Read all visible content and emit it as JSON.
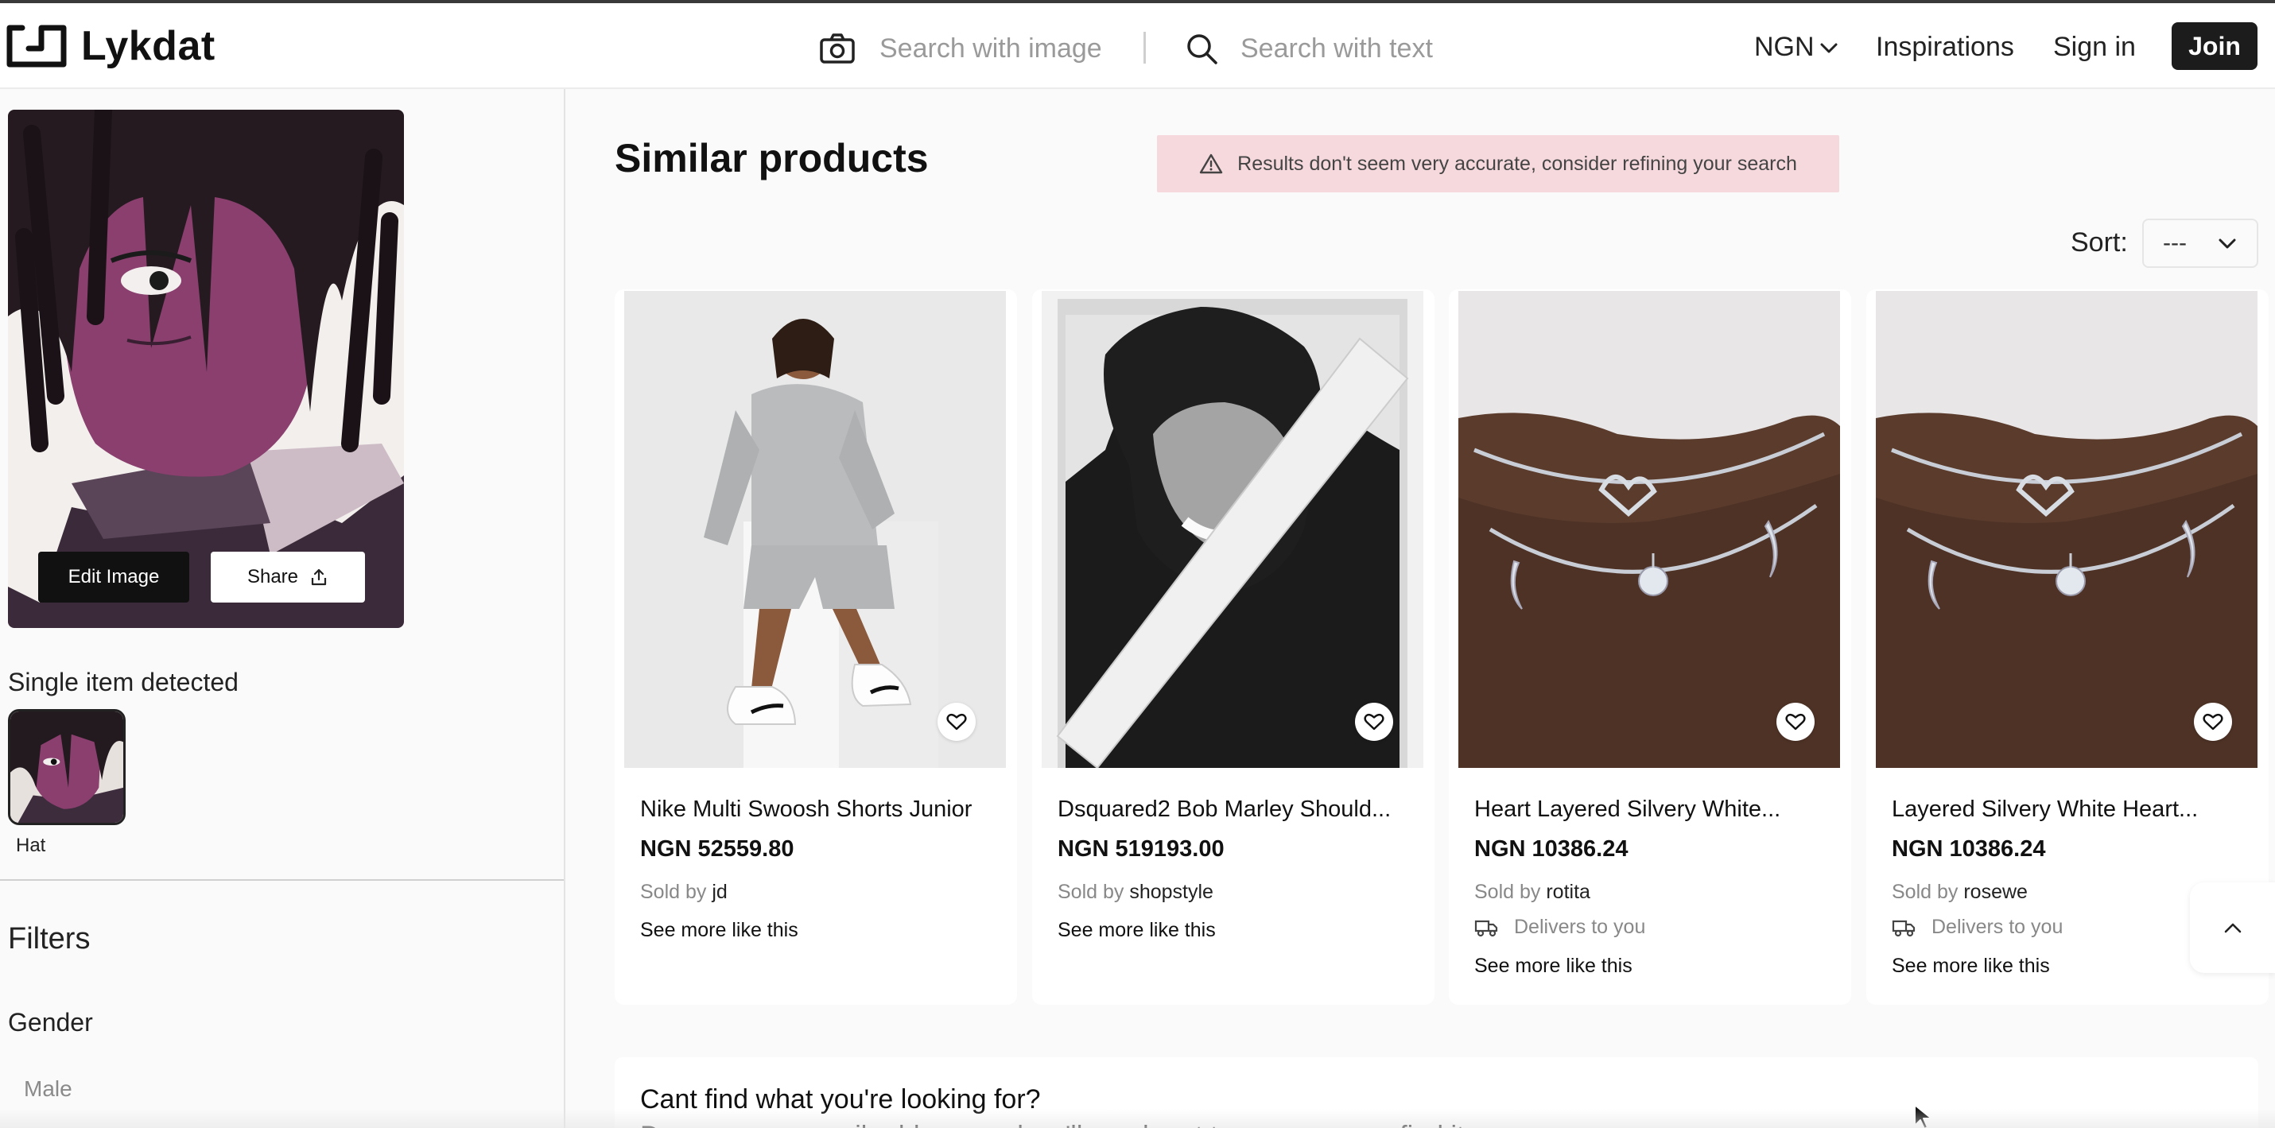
{
  "header": {
    "brand": "Lykdat",
    "search_image_placeholder": "Search with image",
    "search_text_placeholder": "Search with text",
    "currency": "NGN",
    "nav_inspirations": "Inspirations",
    "nav_signin": "Sign in",
    "nav_join": "Join"
  },
  "sidebar": {
    "edit_image": "Edit Image",
    "share": "Share",
    "detected_title": "Single item detected",
    "detected_items": [
      {
        "label": "Hat"
      }
    ],
    "filters_title": "Filters",
    "gender_title": "Gender",
    "gender_options": [
      "Male"
    ]
  },
  "main": {
    "title": "Similar products",
    "warning": "Results don't seem very accurate, consider refining your search",
    "sort_label": "Sort:",
    "sort_value": "---",
    "products": [
      {
        "title": "Nike Multi Swoosh Shorts Junior",
        "price": "NGN 52559.80",
        "sold_by": "Sold by",
        "seller": "jd",
        "delivers": "",
        "more": "See more like this"
      },
      {
        "title": "Dsquared2 Bob Marley Should...",
        "price": "NGN 519193.00",
        "sold_by": "Sold by",
        "seller": "shopstyle",
        "delivers": "",
        "more": "See more like this"
      },
      {
        "title": "Heart Layered Silvery White...",
        "price": "NGN 10386.24",
        "sold_by": "Sold by",
        "seller": "rotita",
        "delivers": "Delivers to you",
        "more": "See more like this"
      },
      {
        "title": "Layered Silvery White Heart...",
        "price": "NGN 10386.24",
        "sold_by": "Sold by",
        "seller": "rosewe",
        "delivers": "Delivers to you",
        "more": "See more like this"
      }
    ],
    "cant_find_title": "Cant find what you're looking for?",
    "cant_find_sub": "Drop us your email address and we'll reach out to you once we find it"
  },
  "icons": {
    "logo": "logo-icon",
    "camera": "camera-icon",
    "search": "search-icon",
    "chevron": "chevron-down-icon",
    "share": "share-icon",
    "warning": "warning-icon",
    "heart": "heart-icon",
    "truck": "truck-icon",
    "scroll_top": "chevron-up-icon"
  },
  "colors": {
    "join_bg": "#1c1c1c",
    "warning_bg": "#f6d9dd",
    "page_bg": "#fafafa"
  }
}
